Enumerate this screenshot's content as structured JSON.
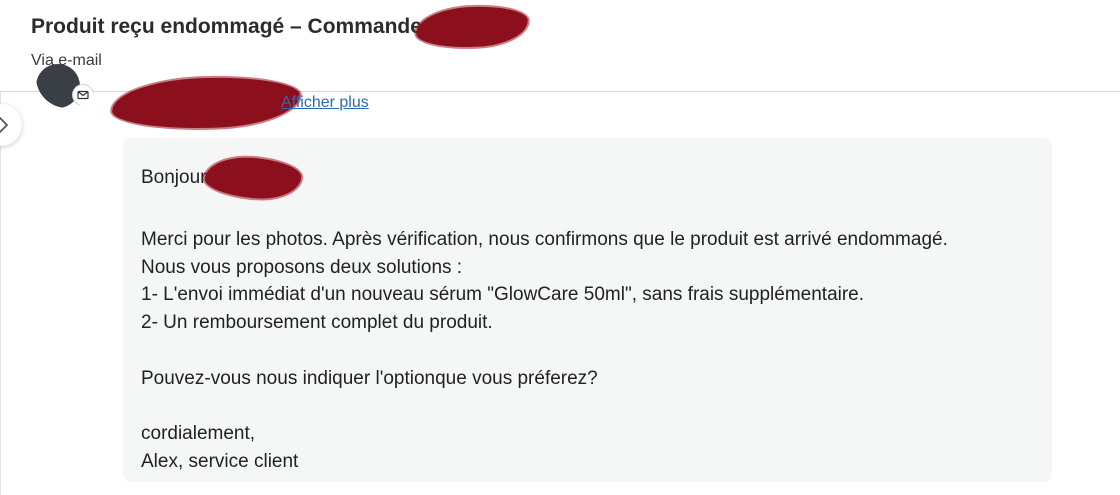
{
  "ticket": {
    "title": "Produit reçu endommagé – Commande",
    "channel": "Via e-mail"
  },
  "sender": {
    "show_more": "Afficher plus"
  },
  "message": {
    "greeting": "Bonjour",
    "lines": [
      "Merci pour les photos. Après vérification, nous confirmons que le produit est arrivé endommagé.",
      "Nous vous proposons deux solutions :",
      "1- L'envoi immédiat d'un nouveau sérum \"GlowCare 50ml\", sans frais supplémentaire.",
      "2- Un remboursement complet du produit.",
      "",
      "Pouvez-vous nous indiquer l'optionque vous préferez?",
      "",
      "cordialement,",
      "Alex, service client"
    ]
  },
  "icons": {
    "side_toggle": "chevron-right-icon",
    "channel_badge": "email-icon"
  },
  "colors": {
    "card_background": "#f5f6f6",
    "link": "#2b6cb0",
    "redaction": "#8b0f1c"
  }
}
